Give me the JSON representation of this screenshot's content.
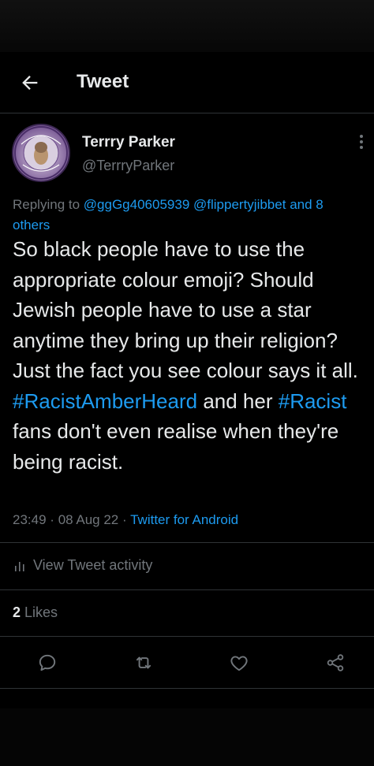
{
  "header": {
    "title": "Tweet",
    "back_icon": "arrow-left-icon"
  },
  "author": {
    "display_name": "Terrry Parker",
    "handle": "@TerrryParker",
    "avatar_badge_text": "Justice for Johnny"
  },
  "reply": {
    "prefix": "Replying to",
    "mentions": [
      "@ggGg40605939",
      "@flippertyjibbet"
    ],
    "others": "and 8 others"
  },
  "tweet": {
    "text_part1": "So black people have to use the appropriate colour emoji? Should Jewish people have to use a star anytime they bring up their religion? Just the fact you see colour says it all.",
    "hashtag1": "#RacistAmberHeard",
    "text_part2": " and her ",
    "hashtag2": "#Racist",
    "text_part3": " fans don't even realise when they're being racist."
  },
  "meta": {
    "time": "23:49",
    "separator": "·",
    "date": "08 Aug 22",
    "source": "Twitter for Android"
  },
  "activity": {
    "label": "View Tweet activity",
    "icon": "bar-chart-icon"
  },
  "likes": {
    "count": "2",
    "label": "Likes"
  },
  "actions": [
    {
      "name": "reply",
      "icon": "comment-icon"
    },
    {
      "name": "retweet",
      "icon": "retweet-icon"
    },
    {
      "name": "like",
      "icon": "heart-icon"
    },
    {
      "name": "share",
      "icon": "share-icon"
    }
  ],
  "colors": {
    "background": "#000000",
    "text": "#e7e9ea",
    "secondary": "#71767b",
    "accent": "#1d9bf0",
    "divider": "#2f3336"
  }
}
